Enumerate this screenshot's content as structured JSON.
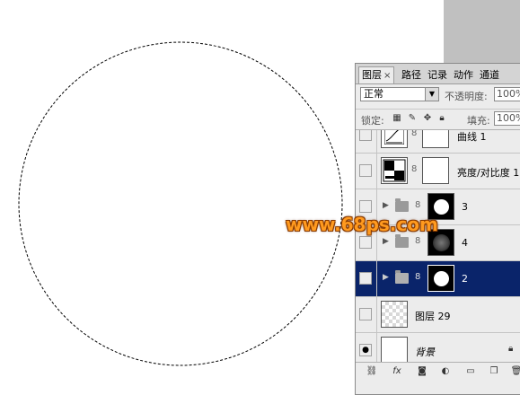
{
  "panel": {
    "tabs": [
      {
        "label": "图层",
        "close": "×"
      },
      {
        "label": "路径"
      },
      {
        "label": "记录"
      },
      {
        "label": "动作"
      },
      {
        "label": "通道"
      }
    ],
    "blend_mode": "正常",
    "opacity_label": "不透明度:",
    "opacity_value": "100%",
    "lock_label": "锁定:",
    "fill_label": "填充:",
    "fill_value": "100%"
  },
  "layers": [
    {
      "name": "曲线 1",
      "type": "adjustment-curves"
    },
    {
      "name": "亮度/对比度 1",
      "type": "adjustment-brightness"
    },
    {
      "name": "3",
      "type": "group-mask",
      "mask": "white-circle"
    },
    {
      "name": "4",
      "type": "group-mask",
      "mask": "blurred-circle"
    },
    {
      "name": "2",
      "type": "group-mask",
      "mask": "white-circle",
      "selected": true
    },
    {
      "name": "图层 29",
      "type": "pixel-transparent"
    },
    {
      "name": "背景",
      "type": "background",
      "visible": true,
      "locked": true
    }
  ],
  "watermark": "www.68ps.com",
  "icons": {
    "eye": "eye-icon",
    "lock": "lock-icon",
    "link": "link-icon",
    "fx": "fx-icon",
    "mask": "mask-icon",
    "adjustment": "adjustment-icon",
    "folder": "folder-icon",
    "new_layer": "new-layer-icon",
    "trash": "trash-icon"
  },
  "colors": {
    "selected_row": "#0a246a",
    "watermark": "#ff9a1f",
    "panel_bg": "#ececec",
    "gray_strip": "#c0c0c0"
  }
}
